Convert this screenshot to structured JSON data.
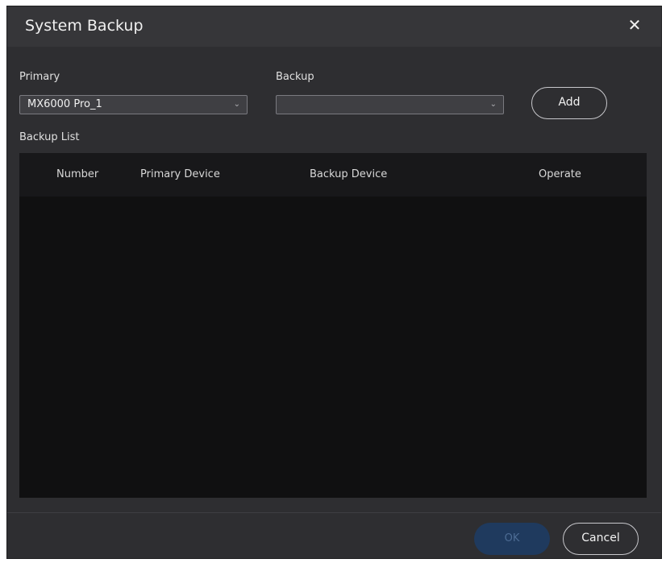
{
  "dialog": {
    "title": "System Backup",
    "close_icon": "close-icon",
    "close_glyph": "✕"
  },
  "form": {
    "primary_label": "Primary",
    "primary_value": "MX6000 Pro_1",
    "backup_label": "Backup",
    "backup_value": "",
    "chevron_icon": "chevron-down-icon",
    "chevron_glyph": "⌄",
    "add_label": "Add"
  },
  "backup_list": {
    "label": "Backup List",
    "columns": [
      "Number",
      "Primary Device",
      "Backup Device",
      "Operate"
    ],
    "rows": []
  },
  "footer": {
    "ok_label": "OK",
    "cancel_label": "Cancel"
  },
  "colors": {
    "dialog_bg": "#2e2e31",
    "table_bg": "#101011",
    "ok_disabled": "#1f3a5e"
  }
}
